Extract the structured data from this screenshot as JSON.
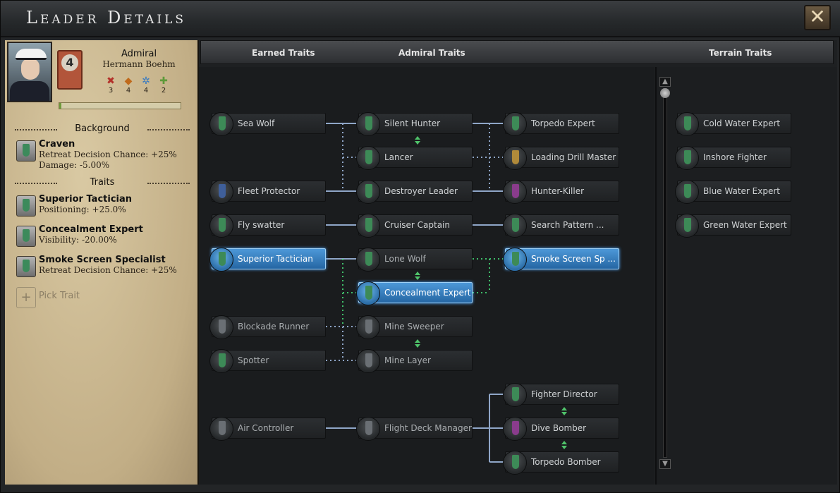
{
  "window": {
    "title": "Leader Details",
    "close_label": "✕"
  },
  "leader": {
    "rank_title": "Admiral",
    "name": "Hermann Boehm",
    "rank_level": "4",
    "skills": [
      {
        "icon": "attack-icon",
        "glyph": "✖",
        "value": "3",
        "color": "#b3312a"
      },
      {
        "icon": "defense-icon",
        "glyph": "◆",
        "value": "4",
        "color": "#c06a1c"
      },
      {
        "icon": "maneuvering-icon",
        "glyph": "✲",
        "value": "4",
        "color": "#3b7bc0"
      },
      {
        "icon": "coordination-icon",
        "glyph": "✚",
        "value": "2",
        "color": "#5e9a3a"
      }
    ],
    "xp_fraction": 0.02
  },
  "background": {
    "header": "Background",
    "trait": {
      "name": "Craven",
      "effects": [
        "Retreat Decision Chance: +25%",
        "Damage: -5.00%"
      ]
    }
  },
  "traits": {
    "header": "Traits",
    "items": [
      {
        "name": "Superior Tactician",
        "effects": [
          "Positioning: +25.0%"
        ]
      },
      {
        "name": "Concealment Expert",
        "effects": [
          "Visibility: -20.00%"
        ]
      },
      {
        "name": "Smoke Screen Specialist",
        "effects": [
          "Retreat Decision Chance: +25%"
        ]
      }
    ],
    "pick_label": "Pick Trait"
  },
  "tabs": {
    "earned": "Earned Traits",
    "admiral": "Admiral Traits",
    "terrain": "Terrain Traits"
  },
  "tree_nodes": {
    "sea_wolf": "Sea Wolf",
    "silent_hunter": "Silent Hunter",
    "torpedo_expert": "Torpedo Expert",
    "lancer": "Lancer",
    "loading_drill_master": "Loading Drill Master",
    "fleet_protector": "Fleet Protector",
    "destroyer_leader": "Destroyer Leader",
    "hunter_killer": "Hunter-Killer",
    "fly_swatter": "Fly swatter",
    "cruiser_captain": "Cruiser Captain",
    "search_pattern": "Search Pattern ...",
    "superior_tactician": "Superior Tactician",
    "lone_wolf": "Lone Wolf",
    "smoke_screen": "Smoke Screen Sp ...",
    "concealment_expert": "Concealment Expert",
    "blockade_runner": "Blockade Runner",
    "mine_sweeper": "Mine Sweeper",
    "spotter": "Spotter",
    "mine_layer": "Mine Layer",
    "fighter_director": "Fighter Director",
    "air_controller": "Air Controller",
    "flight_deck_manager": "Flight Deck Manager",
    "dive_bomber": "Dive Bomber",
    "torpedo_bomber": "Torpedo Bomber"
  },
  "terrain_nodes": {
    "cold_water": "Cold Water Expert",
    "inshore": "Inshore Fighter",
    "blue_water": "Blue Water Expert",
    "green_water": "Green Water Expert"
  },
  "colors": {
    "active": "#3a86c8",
    "link": "#8fa6c8",
    "link_active": "#3fbf6a",
    "arrow": "#4fc36a"
  }
}
